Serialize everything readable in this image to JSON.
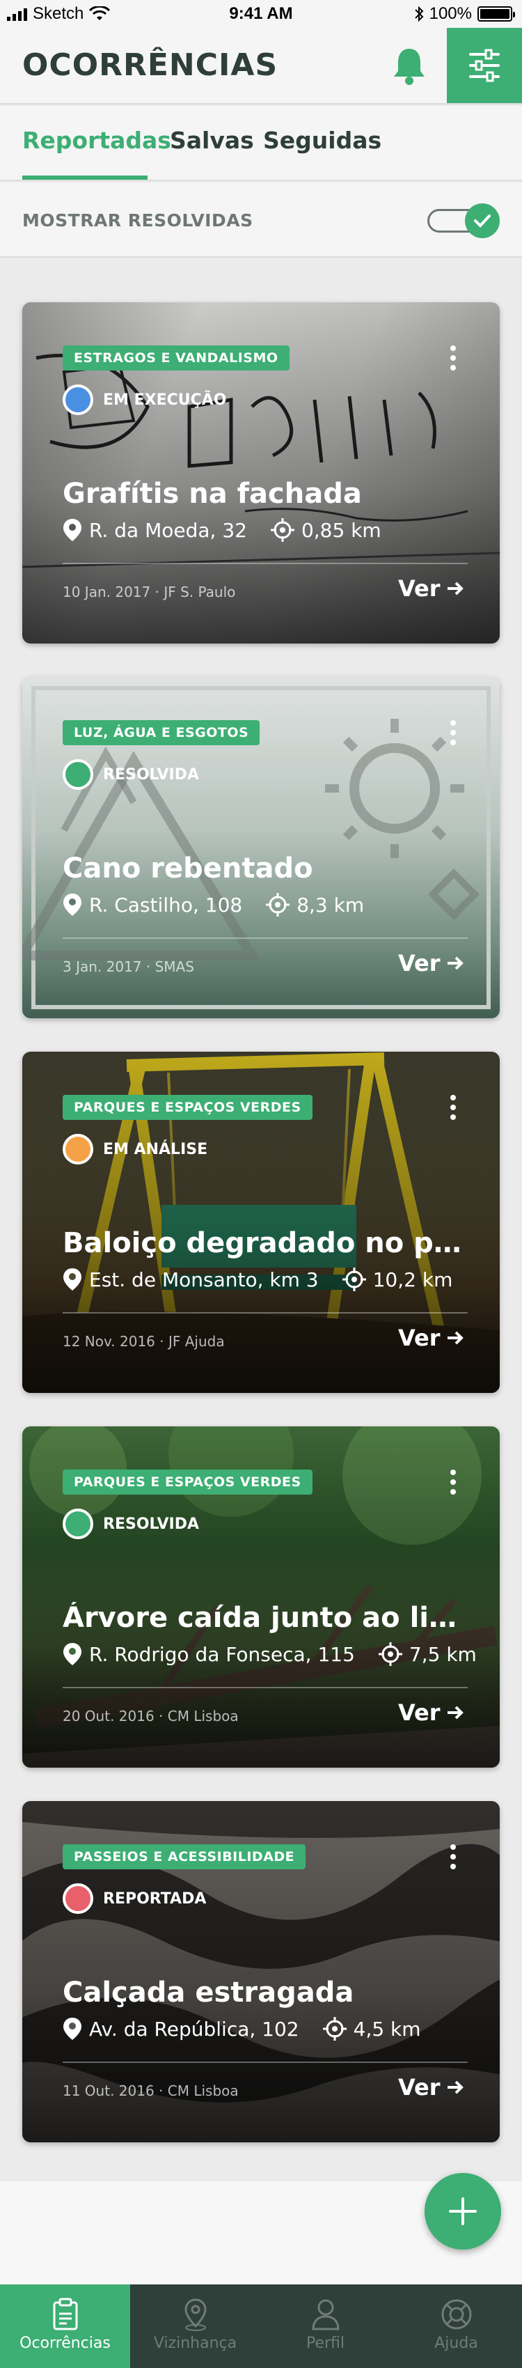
{
  "status_bar": {
    "carrier": "Sketch",
    "time": "9:41 AM",
    "battery": "100%"
  },
  "header": {
    "title": "OCORRÊNCIAS",
    "bell_icon": "bell-icon",
    "filter_icon": "sliders-icon"
  },
  "tabs": [
    {
      "label": "Reportadas",
      "active": true
    },
    {
      "label": "Salvas"
    },
    {
      "label": "Seguidas"
    }
  ],
  "toggle": {
    "label": "MOSTRAR RESOLVIDAS",
    "on": true
  },
  "cards": [
    {
      "category": "ESTRAGOS E VANDALISMO",
      "status": "EM EXECUÇÃO",
      "status_color": "#4a90e2",
      "title": "Grafítis na fachada",
      "address": "R. da Moeda, 32",
      "distance": "0,85 km",
      "meta": "10 Jan. 2017 · JF S. Paulo",
      "action": "Ver"
    },
    {
      "category": "LUZ, ÁGUA E ESGOTOS",
      "status": "RESOLVIDA",
      "status_color": "#3dae74",
      "title": "Cano rebentado",
      "address": "R. Castilho, 108",
      "distance": "8,3 km",
      "meta": "3 Jan. 2017 · SMAS",
      "action": "Ver"
    },
    {
      "category": "PARQUES E ESPAÇOS VERDES",
      "status": "EM ANÁLISE",
      "status_color": "#f5a246",
      "title": "Baloiço degradado no par…",
      "address": "Est. de Monsanto, km 3",
      "distance": "10,2 km",
      "meta": "12 Nov. 2016 · JF Ajuda",
      "action": "Ver"
    },
    {
      "category": "PARQUES E ESPAÇOS VERDES",
      "status": "RESOLVIDA",
      "status_color": "#3dae74",
      "title": "Árvore caída junto ao lice…",
      "address": "R. Rodrigo da Fonseca, 115",
      "distance": "7,5 km",
      "meta": "20 Out. 2016 · CM Lisboa",
      "action": "Ver"
    },
    {
      "category": "PASSEIOS E ACESSIBILIDADE",
      "status": "REPORTADA",
      "status_color": "#e8616a",
      "title": "Calçada estragada",
      "address": "Av. da República, 102",
      "distance": "4,5 km",
      "meta": "11 Out. 2016 · CM Lisboa",
      "action": "Ver"
    }
  ],
  "fab": {
    "icon": "plus-icon"
  },
  "tabbar": [
    {
      "label": "Ocorrências",
      "icon": "report-icon",
      "active": true
    },
    {
      "label": "Vizinhança",
      "icon": "location-icon"
    },
    {
      "label": "Perfil",
      "icon": "user-icon"
    },
    {
      "label": "Ajuda",
      "icon": "lifebuoy-icon"
    }
  ]
}
